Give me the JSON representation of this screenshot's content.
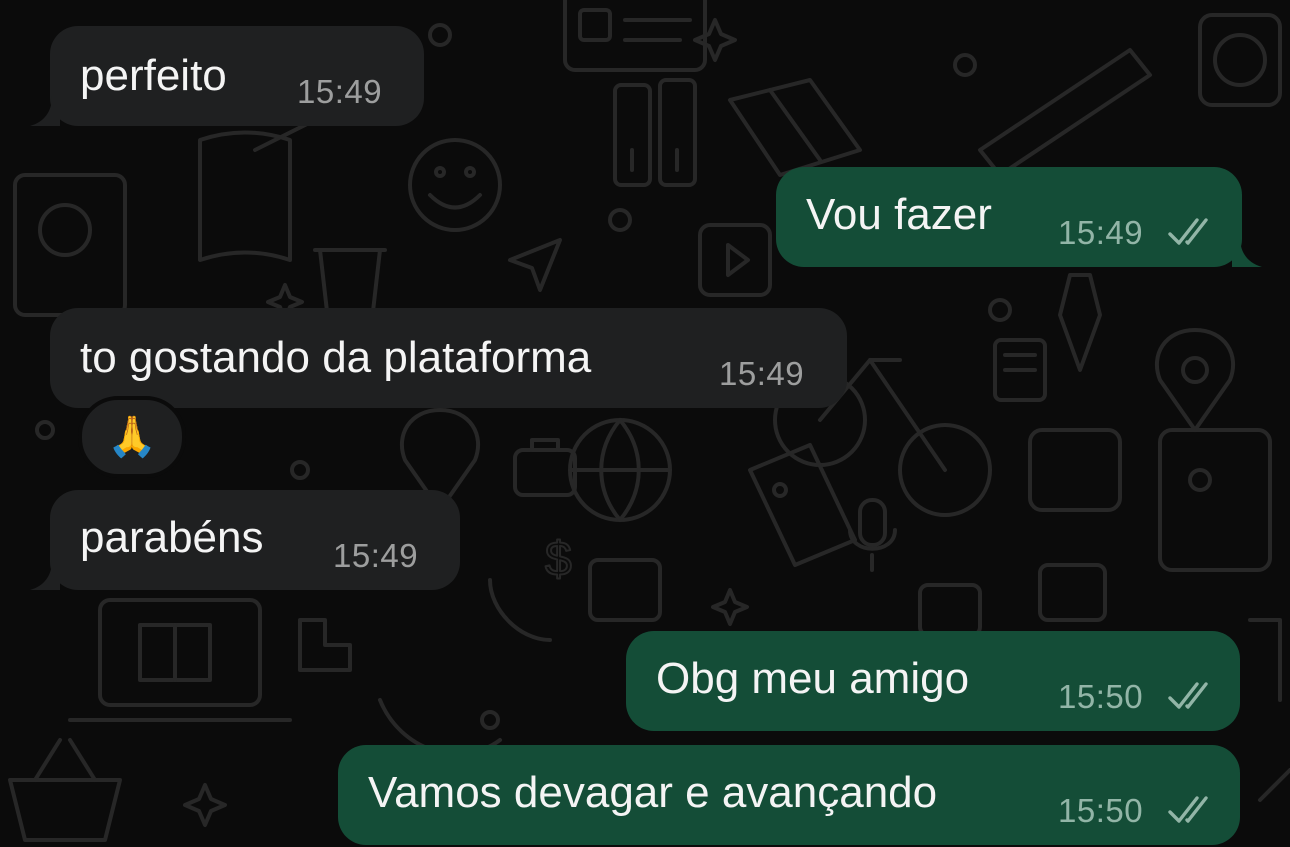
{
  "chat": {
    "messages": [
      {
        "direction": "incoming",
        "text": "perfeito",
        "time": "15:49"
      },
      {
        "direction": "outgoing",
        "text": "Vou fazer",
        "time": "15:49",
        "status": "read-double-check-icon"
      },
      {
        "direction": "incoming",
        "text": "to gostando da plataforma",
        "time": "15:49",
        "reaction": "🙏"
      },
      {
        "direction": "incoming",
        "text": "parabéns",
        "time": "15:49"
      },
      {
        "direction": "outgoing",
        "text": "Obg meu amigo",
        "time": "15:50",
        "status": "read-double-check-icon"
      },
      {
        "direction": "outgoing",
        "text": "Vamos devagar e avançando",
        "time": "15:50",
        "status": "read-double-check-icon"
      }
    ]
  },
  "colors": {
    "background": "#0b0b0b",
    "incoming_bubble": "#1f2021",
    "outgoing_bubble": "#144d37",
    "text": "#f4f4f4",
    "timestamp": "#9a9a9a",
    "wallpaper_doodle": "#262626"
  }
}
